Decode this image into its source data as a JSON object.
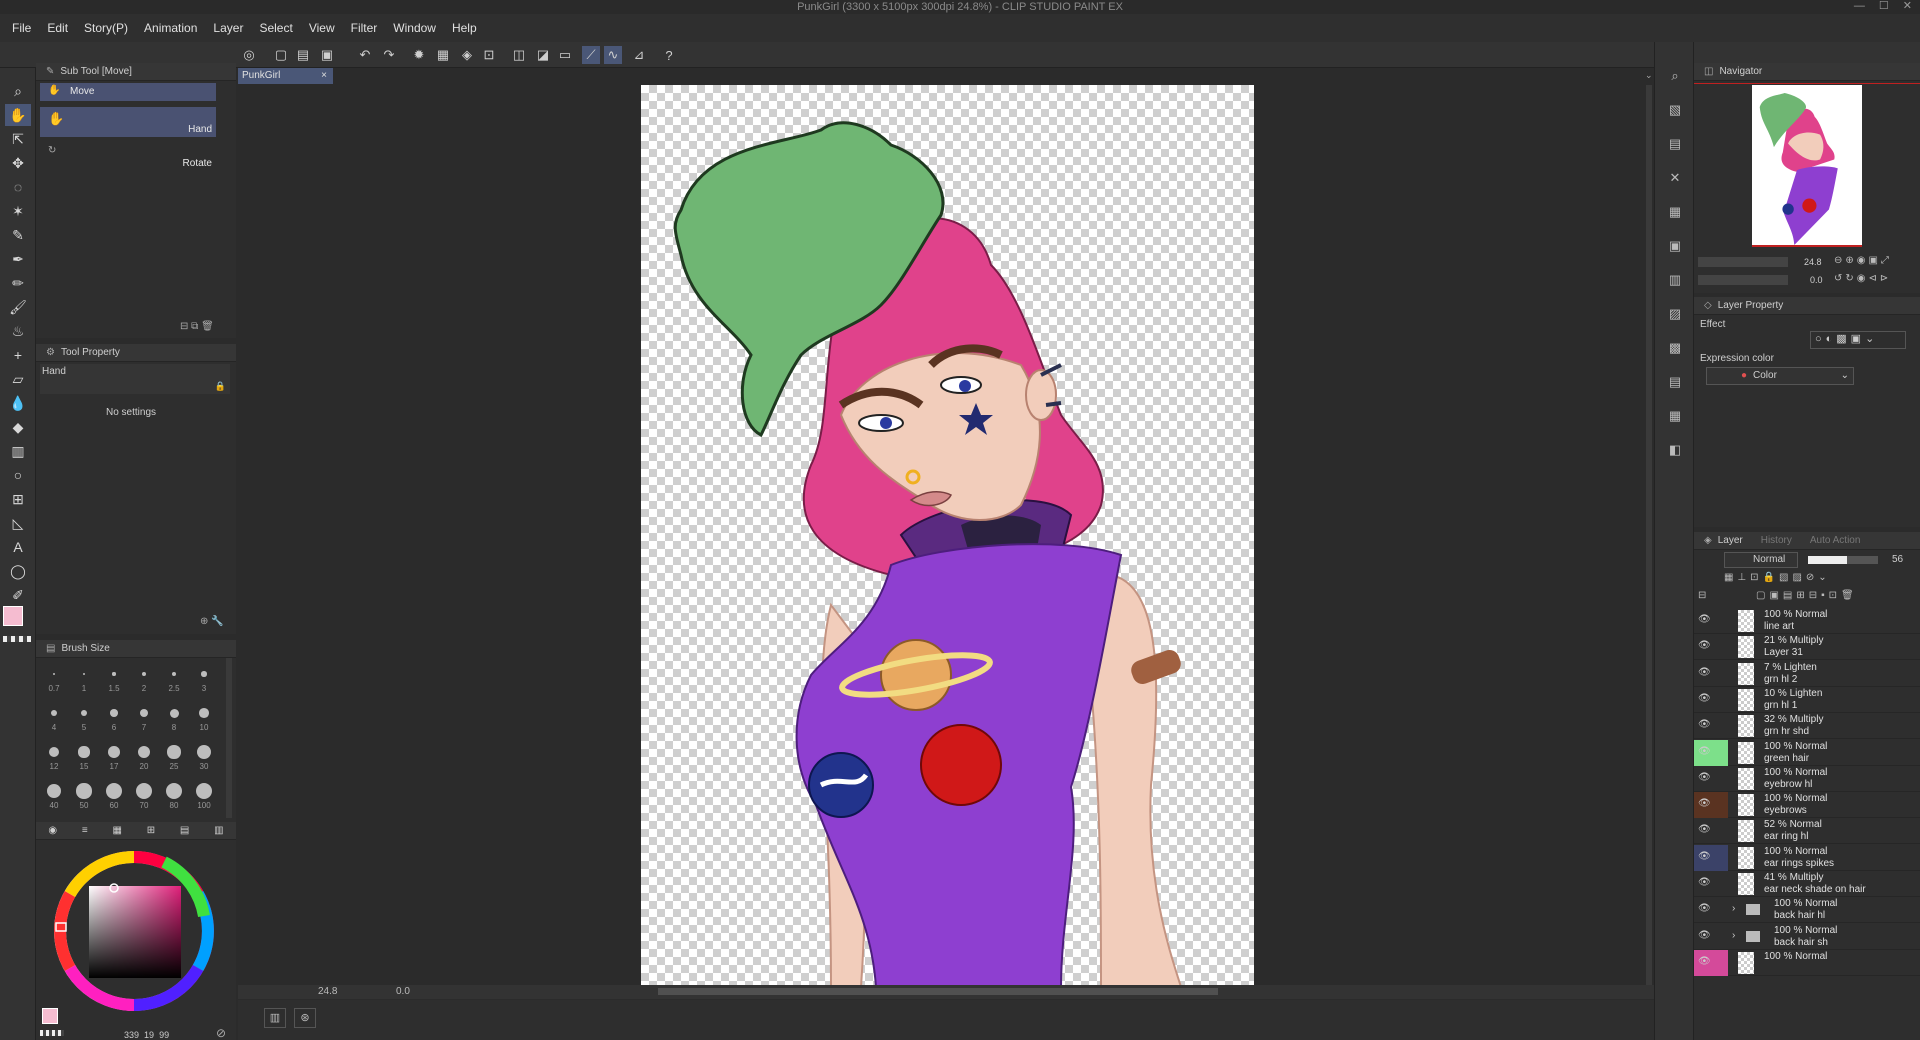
{
  "window": {
    "title": "PunkGirl (3300 x 5100px 300dpi 24.8%) - CLIP STUDIO PAINT EX",
    "controls": [
      "—",
      "☐",
      "✕"
    ]
  },
  "menu": [
    "File",
    "Edit",
    "Story(P)",
    "Animation",
    "Layer",
    "Select",
    "View",
    "Filter",
    "Window",
    "Help"
  ],
  "document_tab": {
    "label": "PunkGirl",
    "close": "×"
  },
  "sub_tool": {
    "header": "Sub Tool [Move]",
    "group": "Move",
    "items": [
      "Hand",
      "Rotate"
    ]
  },
  "tool_property": {
    "header": "Tool Property",
    "tool_name": "Hand",
    "empty_text": "No settings"
  },
  "brush_size": {
    "header": "Brush Size",
    "values": [
      "0.7",
      "1",
      "1.5",
      "2",
      "2.5",
      "3",
      "4",
      "5",
      "6",
      "7",
      "8",
      "10",
      "12",
      "15",
      "17",
      "20",
      "25",
      "30",
      "40",
      "50",
      "60",
      "70",
      "80",
      "100"
    ]
  },
  "color": {
    "main_color": "#f5bcd0",
    "sub_color": "#111111",
    "status": [
      "339",
      "19",
      "99"
    ]
  },
  "canvas_status": {
    "zoom": "24.8",
    "angle": "0.0"
  },
  "navigator": {
    "header": "Navigator",
    "zoom": "24.8",
    "angle": "0.0"
  },
  "layer_property": {
    "header": "Layer Property",
    "effect_label": "Effect",
    "expression_label": "Expression color",
    "expression_value": "Color"
  },
  "layer_panel": {
    "tabs": [
      "Layer",
      "History",
      "Auto Action"
    ],
    "blend_mode": "Normal",
    "opacity": "56",
    "layers": [
      {
        "mode": "100 % Normal",
        "name": "line art",
        "color": ""
      },
      {
        "mode": "21 % Multiply",
        "name": "Layer 31",
        "color": ""
      },
      {
        "mode": "7 % Lighten",
        "name": "grn hl 2",
        "color": ""
      },
      {
        "mode": "10 % Lighten",
        "name": "grn hl 1",
        "color": ""
      },
      {
        "mode": "32 % Multiply",
        "name": "grn hr shd",
        "color": ""
      },
      {
        "mode": "100 % Normal",
        "name": "green hair",
        "color": "#7de08a"
      },
      {
        "mode": "100 % Normal",
        "name": "eyebrow hl",
        "color": ""
      },
      {
        "mode": "100 % Normal",
        "name": "eyebrows",
        "color": "#5a3321"
      },
      {
        "mode": "52 % Normal",
        "name": "ear ring hl",
        "color": ""
      },
      {
        "mode": "100 % Normal",
        "name": "ear rings spikes",
        "color": "#3b4268"
      },
      {
        "mode": "41 % Multiply",
        "name": "ear neck shade on hair",
        "color": ""
      },
      {
        "mode": "100 % Normal",
        "name": "back hair hl",
        "color": "",
        "folder": true
      },
      {
        "mode": "100 % Normal",
        "name": "back hair sh",
        "color": "",
        "folder": true
      },
      {
        "mode": "100 % Normal",
        "name": "",
        "color": "#d44a9a"
      }
    ]
  },
  "colors": {
    "accent": "#4a5777",
    "hair_green": "#6fb673",
    "hair_pink": "#e0428b",
    "shirt": "#8e3fd0",
    "skin": "#f2cdbb"
  }
}
